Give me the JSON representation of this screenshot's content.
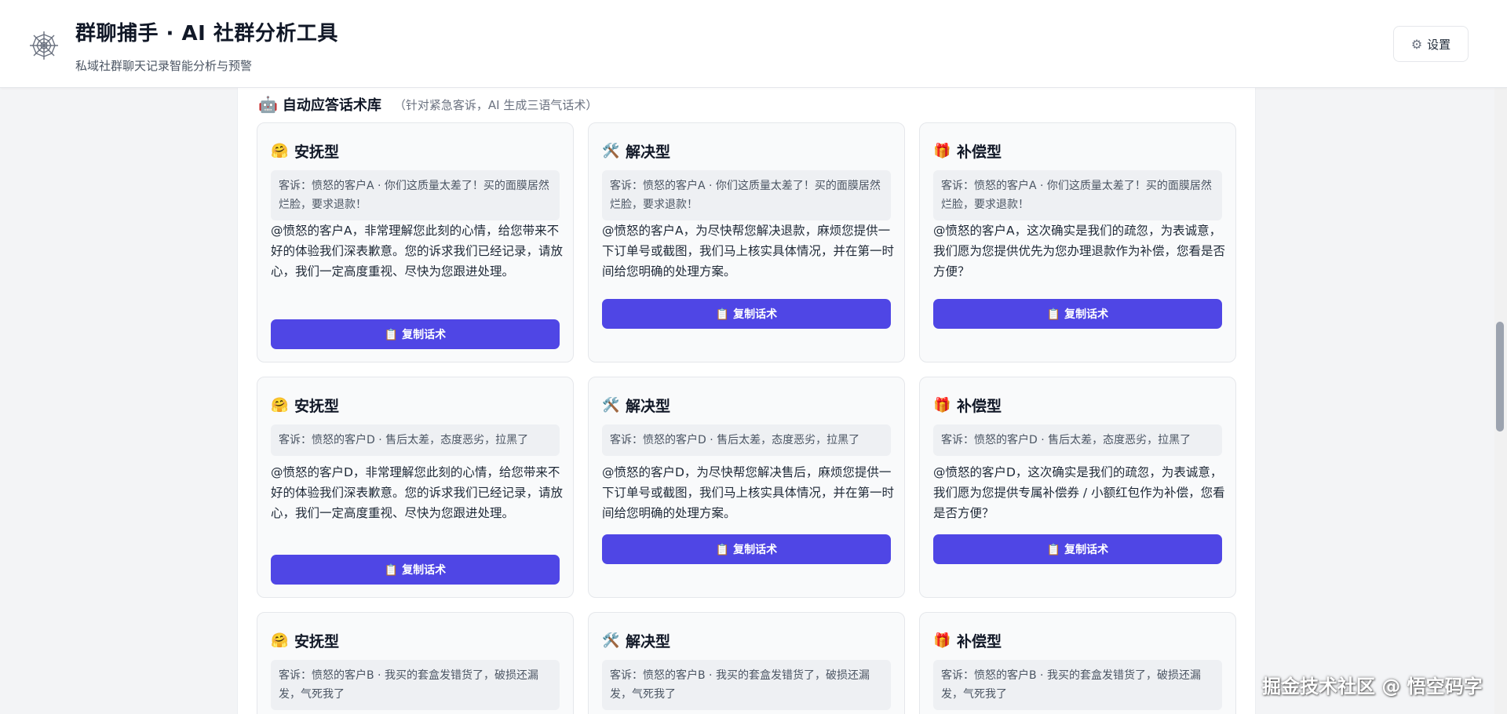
{
  "header": {
    "logo_icon": "spiderweb-icon",
    "title": "群聊捕手 · AI 社群分析工具",
    "subtitle": "私域社群聊天记录智能分析与预警",
    "settings_icon": "gear-icon",
    "settings_label": "设置"
  },
  "section": {
    "icon": "🤖",
    "title": "自动应答话术库",
    "note": "（针对紧急客诉，AI 生成三语气话术）"
  },
  "cards": [
    {
      "icon": "🤗",
      "title": "安抚型",
      "complaint": "客诉：愤怒的客户A · 你们这质量太差了！买的面膜居然烂脸，要求退款！",
      "reply": "@愤怒的客户A，非常理解您此刻的心情，给您带来不好的体验我们深表歉意。您的诉求我们已经记录，请放心，我们一定高度重视、尽快为您跟进处理。",
      "button": "📋 复制话术"
    },
    {
      "icon": "🛠️",
      "title": "解决型",
      "complaint": "客诉：愤怒的客户A · 你们这质量太差了！买的面膜居然烂脸，要求退款！",
      "reply": "@愤怒的客户A，为尽快帮您解决退款，麻烦您提供一下订单号或截图，我们马上核实具体情况，并在第一时间给您明确的处理方案。",
      "button": "📋 复制话术"
    },
    {
      "icon": "🎁",
      "title": "补偿型",
      "complaint": "客诉：愤怒的客户A · 你们这质量太差了！买的面膜居然烂脸，要求退款！",
      "reply": "@愤怒的客户A，这次确实是我们的疏忽，为表诚意，我们愿为您提供优先为您办理退款作为补偿，您看是否方便？",
      "button": "📋 复制话术"
    },
    {
      "icon": "🤗",
      "title": "安抚型",
      "complaint": "客诉：愤怒的客户D · 售后太差，态度恶劣，拉黑了",
      "reply": "@愤怒的客户D，非常理解您此刻的心情，给您带来不好的体验我们深表歉意。您的诉求我们已经记录，请放心，我们一定高度重视、尽快为您跟进处理。",
      "button": "📋 复制话术"
    },
    {
      "icon": "🛠️",
      "title": "解决型",
      "complaint": "客诉：愤怒的客户D · 售后太差，态度恶劣，拉黑了",
      "reply": "@愤怒的客户D，为尽快帮您解决售后，麻烦您提供一下订单号或截图，我们马上核实具体情况，并在第一时间给您明确的处理方案。",
      "button": "📋 复制话术"
    },
    {
      "icon": "🎁",
      "title": "补偿型",
      "complaint": "客诉：愤怒的客户D · 售后太差，态度恶劣，拉黑了",
      "reply": "@愤怒的客户D，这次确实是我们的疏忽，为表诚意，我们愿为您提供专属补偿券 / 小额红包作为补偿，您看是否方便？",
      "button": "📋 复制话术"
    },
    {
      "icon": "🤗",
      "title": "安抚型",
      "complaint": "客诉：愤怒的客户B · 我买的套盒发错货了，破损还漏发，气死我了",
      "reply": "",
      "button": ""
    },
    {
      "icon": "🛠️",
      "title": "解决型",
      "complaint": "客诉：愤怒的客户B · 我买的套盒发错货了，破损还漏发，气死我了",
      "reply": "",
      "button": ""
    },
    {
      "icon": "🎁",
      "title": "补偿型",
      "complaint": "客诉：愤怒的客户B · 我买的套盒发错货了，破损还漏发，气死我了",
      "reply": "",
      "button": ""
    }
  ],
  "watermark": "掘金技术社区 @ 悟空码字",
  "colors": {
    "accent": "#4f46e5",
    "background": "#f3f4f6",
    "card_background": "#f9fafb",
    "complaint_background": "#eef0f3"
  }
}
